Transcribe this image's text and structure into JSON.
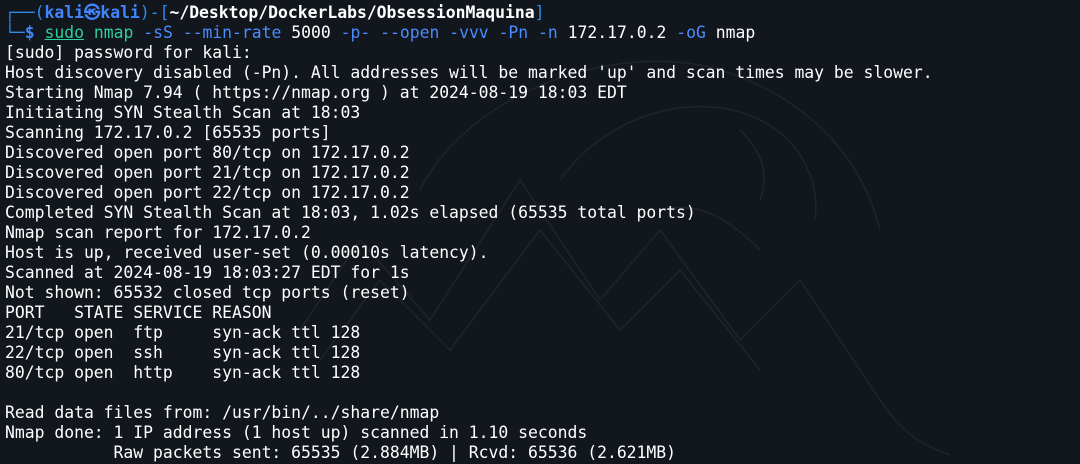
{
  "prompt": {
    "corner_top": "┌──(",
    "user": "kali",
    "at_symbol": "㉿",
    "host": "kali",
    "close_paren": ")-[",
    "path": "~/Desktop/DockerLabs/ObsessionMaquina",
    "close_bracket": "]",
    "corner_bottom": "└─",
    "dollar": "$"
  },
  "command": {
    "sudo": "sudo",
    "program": "nmap",
    "arg1": "-sS",
    "arg2": "--min-rate",
    "arg3": "5000",
    "arg4": "-p-",
    "arg5": "--open",
    "arg6": "-vvv",
    "arg7": "-Pn",
    "arg8": "-n",
    "target": "172.17.0.2",
    "arg9": "-oG",
    "outfile": "nmap"
  },
  "output": [
    "[sudo] password for kali:",
    "Host discovery disabled (-Pn). All addresses will be marked 'up' and scan times may be slower.",
    "Starting Nmap 7.94 ( https://nmap.org ) at 2024-08-19 18:03 EDT",
    "Initiating SYN Stealth Scan at 18:03",
    "Scanning 172.17.0.2 [65535 ports]",
    "Discovered open port 80/tcp on 172.17.0.2",
    "Discovered open port 21/tcp on 172.17.0.2",
    "Discovered open port 22/tcp on 172.17.0.2",
    "Completed SYN Stealth Scan at 18:03, 1.02s elapsed (65535 total ports)",
    "Nmap scan report for 172.17.0.2",
    "Host is up, received user-set (0.00010s latency).",
    "Scanned at 2024-08-19 18:03:27 EDT for 1s",
    "Not shown: 65532 closed tcp ports (reset)",
    "PORT   STATE SERVICE REASON",
    "21/tcp open  ftp     syn-ack ttl 128",
    "22/tcp open  ssh     syn-ack ttl 128",
    "80/tcp open  http    syn-ack ttl 128",
    "",
    "Read data files from: /usr/bin/../share/nmap",
    "Nmap done: 1 IP address (1 host up) scanned in 1.10 seconds",
    "           Raw packets sent: 65535 (2.884MB) | Rcvd: 65536 (2.621MB)"
  ],
  "colors": {
    "background": "#12161d",
    "prompt_blue": "#3f86ff",
    "command_green": "#2ecf9b",
    "text": "#ffffff"
  },
  "watermark_icon": "kali-dragon-watermark-icon"
}
